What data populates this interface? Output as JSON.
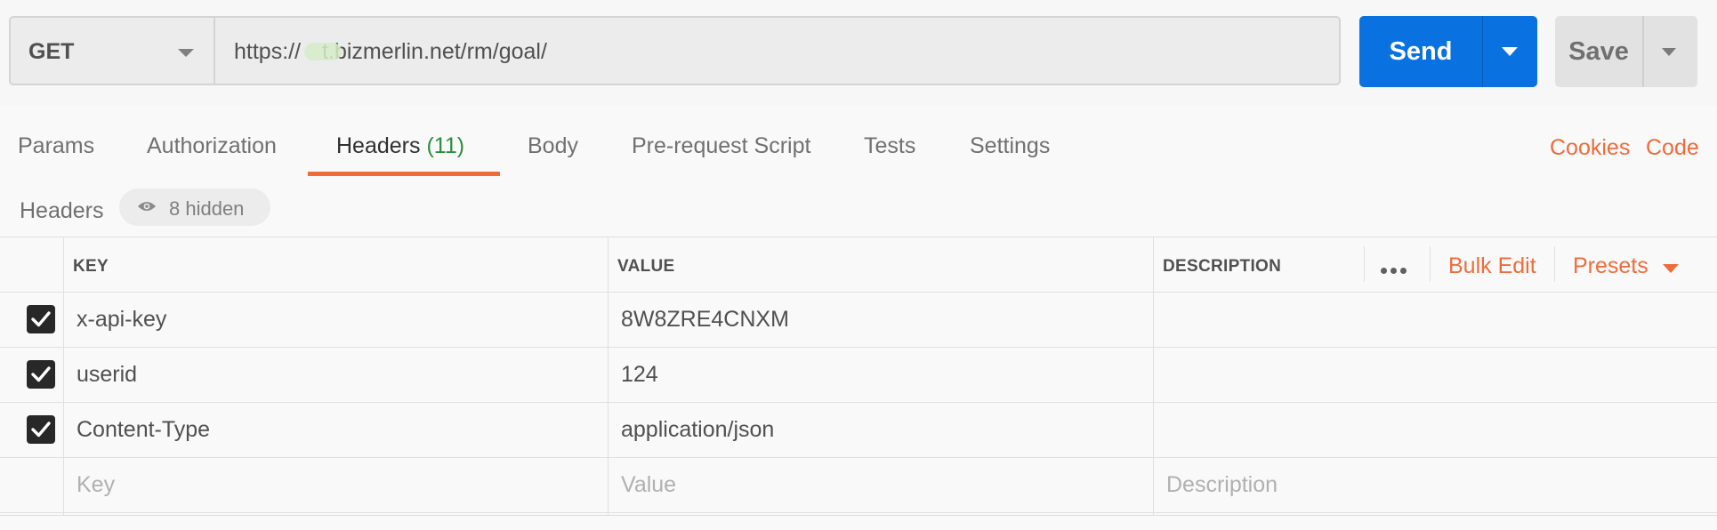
{
  "request": {
    "method": "GET",
    "url": "https://",
    "url_rest": "t.bizmerlin.net/rm/goal/",
    "send_label": "Send",
    "save_label": "Save"
  },
  "tabs": [
    {
      "label": "Params"
    },
    {
      "label": "Authorization"
    },
    {
      "label": "Headers",
      "count": "(11)",
      "active": true
    },
    {
      "label": "Body"
    },
    {
      "label": "Pre-request Script"
    },
    {
      "label": "Tests"
    },
    {
      "label": "Settings"
    }
  ],
  "tab_links": {
    "cookies": "Cookies",
    "code": "Code"
  },
  "headers_section": {
    "title": "Headers",
    "hidden_label": "8 hidden"
  },
  "table": {
    "columns": {
      "key": "KEY",
      "value": "VALUE",
      "description": "DESCRIPTION"
    },
    "actions": {
      "bulk_edit": "Bulk Edit",
      "presets": "Presets"
    },
    "rows": [
      {
        "key": "x-api-key",
        "value": "8W8ZRE4CNXM",
        "checked": true
      },
      {
        "key": "userid",
        "value": "124",
        "checked": true
      },
      {
        "key": "Content-Type",
        "value": "application/json",
        "checked": true
      }
    ],
    "placeholders": {
      "key": "Key",
      "value": "Value",
      "description": "Description"
    }
  },
  "colors": {
    "primary": "#0a72e0",
    "accent": "#ef6c3a",
    "count": "#2a8f3c"
  }
}
